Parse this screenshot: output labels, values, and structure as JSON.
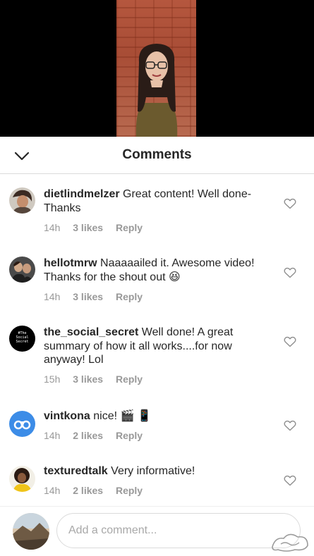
{
  "header": {
    "title": "Comments"
  },
  "comments": [
    {
      "username": "dietlindmelzer",
      "text": "Great content! Well done- Thanks",
      "time": "14h",
      "likes": "3 likes",
      "reply": "Reply"
    },
    {
      "username": "hellotmrw",
      "text": "Naaaaailed it. Awesome video! Thanks for the shout out 😆",
      "time": "14h",
      "likes": "3 likes",
      "reply": "Reply"
    },
    {
      "username": "the_social_secret",
      "text": "Well done!  A great summary of how it all works....for now anyway! Lol",
      "time": "15h",
      "likes": "3 likes",
      "reply": "Reply",
      "avatar_text": "#The Social Secret"
    },
    {
      "username": "vintkona",
      "text": "nice! 🎬 📱",
      "time": "14h",
      "likes": "2 likes",
      "reply": "Reply"
    },
    {
      "username": "texturedtalk",
      "text": "Very informative!",
      "time": "14h",
      "likes": "2 likes",
      "reply": "Reply"
    }
  ],
  "footer": {
    "placeholder": "Add a comment..."
  },
  "colors": {
    "meta": "#999999",
    "border": "#dbdbdb",
    "vintkona_avatar": "#3c8ce7"
  }
}
